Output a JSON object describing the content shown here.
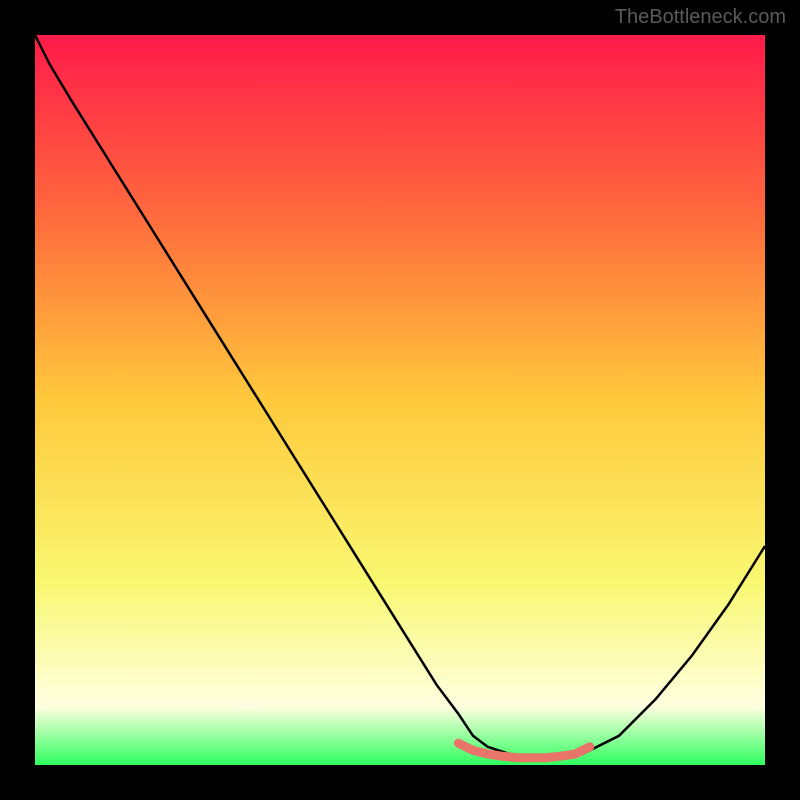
{
  "watermark": "TheBottleneck.com",
  "chart_data": {
    "type": "line",
    "title": "",
    "xlabel": "",
    "ylabel": "",
    "xlim": [
      0,
      100
    ],
    "ylim": [
      0,
      100
    ],
    "gradient_stops": [
      {
        "offset": 0,
        "color": "#ff1a4a"
      },
      {
        "offset": 25,
        "color": "#ff6b3d"
      },
      {
        "offset": 50,
        "color": "#ffc93c"
      },
      {
        "offset": 75,
        "color": "#f9f871"
      },
      {
        "offset": 92,
        "color": "#ffffe0"
      },
      {
        "offset": 100,
        "color": "#2eff5e"
      }
    ],
    "series": [
      {
        "name": "curve",
        "color": "#000000",
        "x": [
          0,
          2,
          5,
          10,
          15,
          20,
          25,
          30,
          35,
          40,
          45,
          50,
          55,
          58,
          60,
          62,
          65,
          68,
          70,
          72,
          75,
          80,
          85,
          90,
          95,
          100
        ],
        "y": [
          100,
          96,
          91,
          83,
          75,
          67,
          59,
          51,
          43,
          35,
          27,
          19,
          11,
          7,
          4,
          2.5,
          1.5,
          1,
          1,
          1,
          1.5,
          4,
          9,
          15,
          22,
          30
        ]
      },
      {
        "name": "highlight",
        "color": "#e8746a",
        "x": [
          58,
          60,
          62,
          64,
          66,
          68,
          70,
          72,
          74,
          76
        ],
        "y": [
          3,
          2,
          1.5,
          1.2,
          1,
          1,
          1,
          1.2,
          1.5,
          2.5
        ]
      }
    ]
  }
}
